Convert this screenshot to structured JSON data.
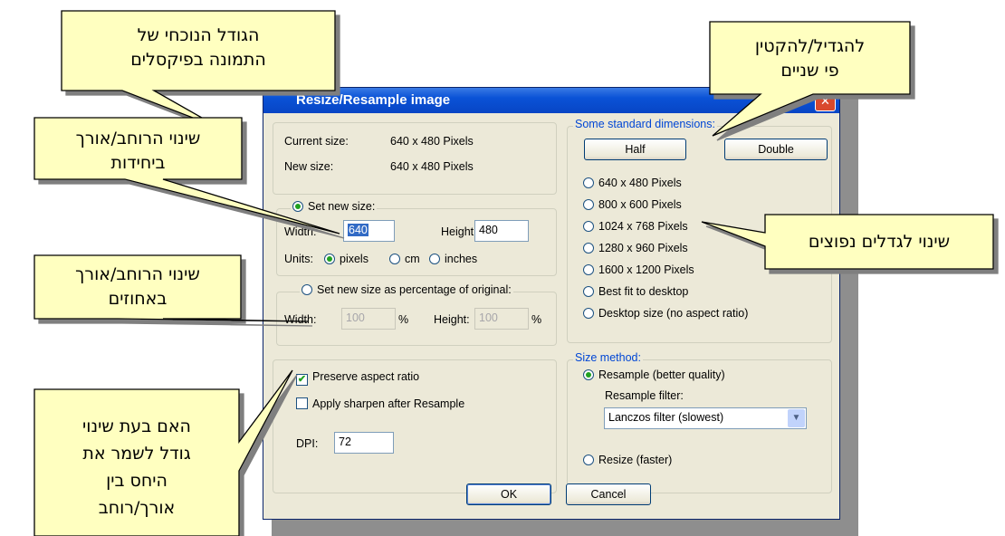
{
  "dialog": {
    "title": "Resize/Resample image",
    "close_label": "✕"
  },
  "current": {
    "current_label": "Current size:",
    "current_value": "640  x  480  Pixels",
    "new_label": "New size:",
    "new_value": "640  x  480  Pixels"
  },
  "set_size": {
    "radio_label": "Set new size:",
    "width_label": "Width:",
    "width_value": "640",
    "height_label": "Height:",
    "height_value": "480",
    "units_label": "Units:",
    "unit_pixels": "pixels",
    "unit_cm": "cm",
    "unit_inches": "inches"
  },
  "percent": {
    "radio_label": "Set new size as percentage of original:",
    "width_label": "Width:",
    "width_value": "100",
    "pct1": "%",
    "height_label": "Height:",
    "height_value": "100",
    "pct2": "%"
  },
  "options": {
    "preserve": "Preserve aspect ratio",
    "sharpen": "Apply sharpen after Resample",
    "dpi_label": "DPI:",
    "dpi_value": "72"
  },
  "standard": {
    "group_label": "Some standard dimensions:",
    "half": "Half",
    "double": "Double",
    "items": [
      "640 x 480 Pixels",
      "800 x 600 Pixels",
      "1024 x 768 Pixels",
      "1280 x 960 Pixels",
      "1600 x 1200 Pixels",
      "Best fit to desktop",
      "Desktop size (no aspect ratio)"
    ]
  },
  "method": {
    "group_label": "Size method:",
    "resample": "Resample (better quality)",
    "filter_label": "Resample filter:",
    "filter_value": "Lanczos filter (slowest)",
    "resize": "Resize (faster)"
  },
  "buttons": {
    "ok": "OK",
    "cancel": "Cancel"
  },
  "callouts": {
    "current_size": [
      "הגודל הנוכחי של",
      "התמונה בפיקסלים"
    ],
    "half_double": [
      "להגדיל/להקטין",
      "פי שניים"
    ],
    "units": [
      "שינוי הרוחב/אורך",
      "ביחידות"
    ],
    "common_sizes": [
      "שינוי לגדלים נפוצים"
    ],
    "percent": [
      "שינוי הרוחב/אורך",
      "באחוזים"
    ],
    "aspect": [
      "האם בעת שינוי",
      "גודל לשמר את",
      "היחס בין",
      "אורך/רוחב"
    ]
  },
  "colors": {
    "callout_fill": "#ffffc0",
    "title_bar": "#0a52d6",
    "dialog_bg": "#ece9d8"
  }
}
